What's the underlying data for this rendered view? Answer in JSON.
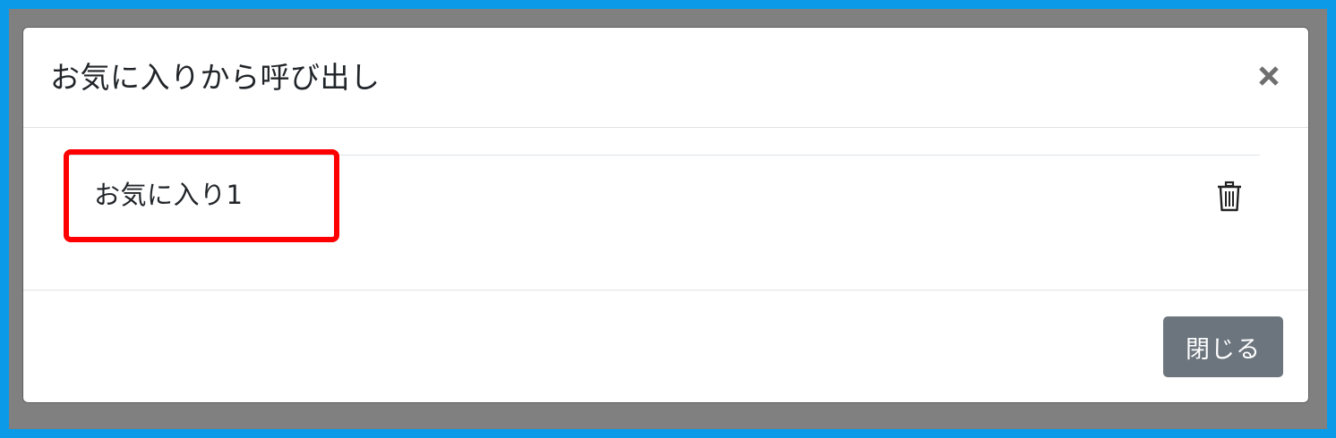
{
  "modal": {
    "title": "お気に入りから呼び出し",
    "close_icon": "close-x-icon"
  },
  "favorites": [
    {
      "label": "お気に入り1",
      "delete_icon": "trash-icon"
    }
  ],
  "footer": {
    "close_label": "閉じる"
  },
  "colors": {
    "outer_border": "#0a9ae8",
    "backdrop": "#808080",
    "highlight": "#ff0000",
    "secondary_button": "#6c757d"
  }
}
